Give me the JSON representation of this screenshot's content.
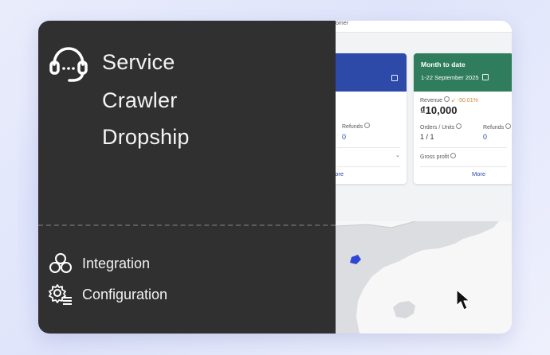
{
  "sidebar": {
    "brand": {
      "icon": "headset-icon",
      "lines": [
        "Service",
        "Crawler",
        "Dropship"
      ]
    },
    "nav": [
      {
        "label": "Integration",
        "icon": "integration-icon"
      },
      {
        "label": "Configuration",
        "icon": "settings-gear-icon"
      }
    ]
  },
  "dashboard": {
    "topbar_text": "omer",
    "left_card": {
      "refunds_label": "Refunds",
      "refunds_value": "0",
      "more": "More"
    },
    "right_card": {
      "title": "Month to date",
      "date_range": "1-22 September 2025",
      "revenue_label": "Revenue",
      "revenue_change": "↙ -50.01%",
      "revenue_value": "₫10,000",
      "orders_label": "Orders / Units",
      "orders_value": "1 / 1",
      "refunds_label": "Refunds",
      "refunds_value": "0",
      "gross_profit_label": "Gross profit",
      "more": "More"
    }
  },
  "colors": {
    "sidebar_bg": "#303030",
    "card_blue": "#2e4aa8",
    "card_green": "#2f7d5c",
    "change_orange": "#d08a3a"
  }
}
